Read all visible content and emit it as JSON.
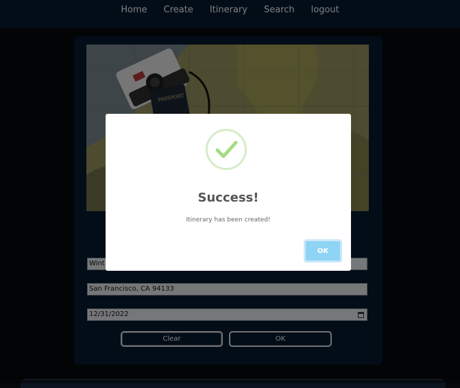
{
  "nav": {
    "items": [
      "Home",
      "Create",
      "Itinerary",
      "Search",
      "logout"
    ]
  },
  "form": {
    "title_value": "Wint",
    "location_value": "San Francisco, CA 94133",
    "date_value": "12/31/2022",
    "clear_label": "Clear",
    "ok_label": "OK"
  },
  "hero": {
    "passport_text": "PASSPORT"
  },
  "modal": {
    "title": "Success!",
    "message": "Itinerary has been created!",
    "ok_label": "OK",
    "icon": "check-icon",
    "accent_color": "#8fd3f5",
    "success_color": "#a5dc86"
  }
}
